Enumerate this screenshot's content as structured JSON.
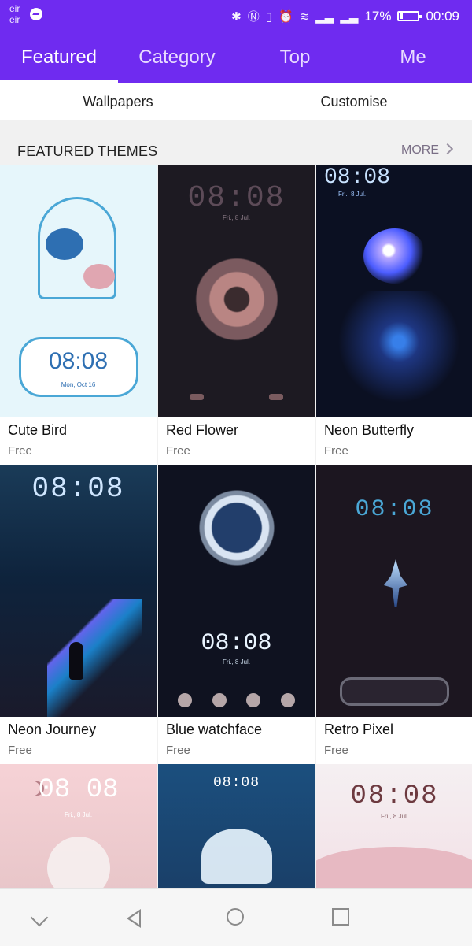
{
  "status_bar": {
    "carrier_lines": [
      "eir",
      "eir"
    ],
    "battery_percent": "17%",
    "time": "00:09",
    "icons": [
      "bluetooth-icon",
      "nfc-icon",
      "vibrate-icon",
      "alarm-icon",
      "wifi-icon",
      "signal-icon",
      "signal-icon",
      "battery-icon"
    ],
    "accent_color": "#6f2bf0"
  },
  "top_tabs": [
    {
      "label": "Featured",
      "active": true
    },
    {
      "label": "Category",
      "active": false
    },
    {
      "label": "Top",
      "active": false
    },
    {
      "label": "Me",
      "active": false
    }
  ],
  "sub_tabs": [
    "Wallpapers",
    "Customise"
  ],
  "featured": {
    "title": "FEATURED THEMES",
    "more_label": "MORE",
    "items": [
      {
        "name": "Cute Bird",
        "price": "Free",
        "time": "08:08",
        "date": "Mon, Oct 16"
      },
      {
        "name": "Red Flower",
        "price": "Free",
        "time": "08:08",
        "date": "Fri., 8 Jul."
      },
      {
        "name": "Neon Butterfly",
        "price": "Free",
        "time": "08:08",
        "date": "Fri., 8 Jul."
      },
      {
        "name": "Neon Journey",
        "price": "Free",
        "time": "08:08",
        "date": ""
      },
      {
        "name": "Blue watchface",
        "price": "Free",
        "time": "08:08",
        "date": "Fri., 8 Jul."
      },
      {
        "name": "Retro Pixel",
        "price": "Free",
        "time": "08:08",
        "date": ""
      },
      {
        "name": "",
        "price": "",
        "time": "08 08",
        "date": "Fri., 8 Jul."
      },
      {
        "name": "",
        "price": "",
        "time": "08:08",
        "date": ""
      },
      {
        "name": "",
        "price": "",
        "time": "08:08",
        "date": "Fri., 8 Jul."
      }
    ]
  },
  "nav": {
    "icons": [
      "chevron-down-icon",
      "back-icon",
      "home-icon",
      "recent-apps-icon"
    ]
  }
}
